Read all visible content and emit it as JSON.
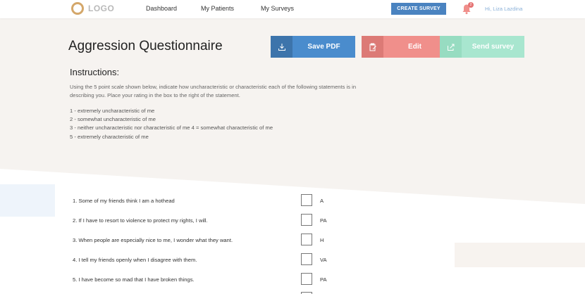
{
  "header": {
    "logo_text": "LOGO",
    "nav": {
      "dashboard": "Dashboard",
      "patients": "My Patients",
      "surveys": "My Surveys"
    },
    "create_survey_label": "CREATE SURVEY",
    "notification_count": "2",
    "user_greeting": "Hi, Liza Lazdina"
  },
  "page": {
    "title": "Aggression Questionnaire",
    "actions": {
      "save_pdf": "Save PDF",
      "edit": "Edit",
      "send_survey": "Send survey"
    }
  },
  "instructions": {
    "title": "Instructions:",
    "text": "Using the 5 point scale shown below, indicate how uncharacteristic or characteristic each of the following statements is in describing you. Place your rating in the box to the right of the statement.",
    "scale": [
      "1 - extremely uncharacteristic of me",
      "2 - somewhat uncharacteristic of me",
      "3 - neither uncharacteristic nor characteristic of me 4 = somewhat characteristic of me",
      "5 - extremely characteristic of me"
    ]
  },
  "questions": [
    {
      "text": "1. Some of my friends think I am a hothead",
      "code": "A"
    },
    {
      "text": "2. If I have to resort to violence to protect my rights, I will.",
      "code": "PA"
    },
    {
      "text": "3. When people are especially nice to me, I wonder what they want.",
      "code": "H"
    },
    {
      "text": "4. I tell my friends openly when I disagree with them.",
      "code": "VA"
    },
    {
      "text": "5. I have become so mad that I have broken things.",
      "code": "PA"
    }
  ],
  "colors": {
    "primary": "#4a8ccd",
    "edit": "#f08f8b",
    "send": "#a8e6cf",
    "logo": "#d4a76a",
    "background": "#f6f3f0"
  }
}
